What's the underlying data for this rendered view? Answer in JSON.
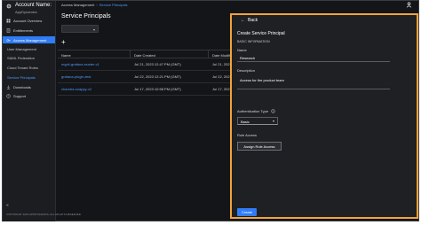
{
  "account": {
    "name": "Account Name:",
    "org": "AppDynamics"
  },
  "sidebar": {
    "items": [
      {
        "label": "Account Overview",
        "icon": "grid-icon"
      },
      {
        "label": "Entitlements",
        "icon": "document-icon"
      },
      {
        "label": "Access Management",
        "icon": "key-icon"
      },
      {
        "label": "User Management"
      },
      {
        "label": "SAML Federation"
      },
      {
        "label": "Cloud Tenant Roles"
      },
      {
        "label": "Service Principals"
      },
      {
        "label": "Downloads",
        "icon": "download-icon"
      },
      {
        "label": "Support",
        "icon": "help-icon"
      }
    ],
    "collapse_icon": "chevron-double-left-icon",
    "copyright": "COPYRIGHT 2023 APPDYNAMICS. ALL RIGHTS RESERVED."
  },
  "header": {
    "breadcrumb_parent": "Access Management",
    "breadcrumb_current": "Service Principals",
    "separator": "›"
  },
  "main": {
    "title": "Service Principals",
    "filter_value": "",
    "add_label": "+"
  },
  "table": {
    "columns": [
      "Name",
      "Date Created",
      "Date Modified"
    ],
    "rows": [
      {
        "name": "mypit-grafana-reader-v1",
        "created": "Jul 21, 2023 12:47 PM (GMT)",
        "modified": "Jul 21, 2023"
      },
      {
        "name": "grafana-plugin-test",
        "created": "Jul 22, 2023 12:21 PM (GMT)",
        "modified": "Jul 22, 2023"
      },
      {
        "name": "chandra-snappy-v2",
        "created": "Jul 17, 2023 10:58 PM (GMT)",
        "modified": "Jul 17, 2023"
      }
    ]
  },
  "drawer": {
    "back_label": "Back",
    "title": "Create Service Principal",
    "section_basic": "BASIC INFORMATION",
    "name_label": "Name",
    "name_value": "Research",
    "description_label": "Description",
    "description_value": "Access for the product team",
    "auth_label": "Authentication Type",
    "auth_value": "Basic",
    "role_section": "Role Access",
    "assign_label": "Assign Role Access",
    "create_label": "Create"
  },
  "colors": {
    "accent": "#2f7cf6",
    "link": "#4f9bff",
    "highlight_border": "#f1a43a",
    "background": "#141518"
  }
}
